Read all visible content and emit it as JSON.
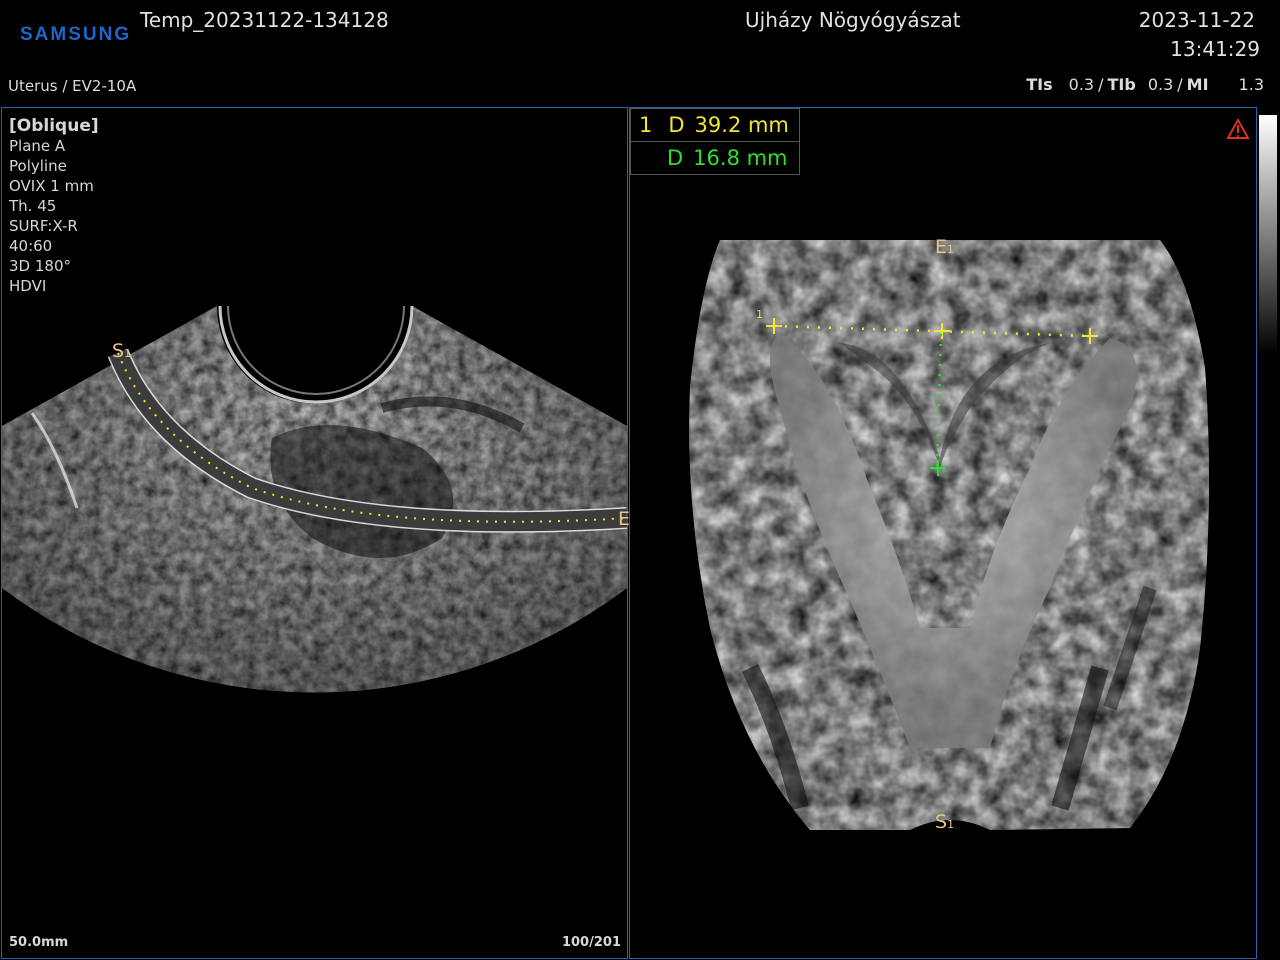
{
  "header": {
    "brand": "SAMSUNG",
    "file_name": "Temp_20231122-134128",
    "institution": "Ujházy Nögyógyászat",
    "date": "2023-11-22",
    "time": "13:41:29",
    "probe": "Uterus / EV2-10A",
    "tis_label": "TIs",
    "tis_value": "0.3",
    "tib_label": "TIb",
    "tib_value": "0.3",
    "mi_label": "MI",
    "mi_value": "1.3"
  },
  "left_panel": {
    "info": [
      "[Oblique]",
      "Plane A",
      "Polyline",
      "OVIX 1 mm",
      "Th. 45",
      "SURF:X-R",
      "40:60",
      "3D 180°",
      "HDVI"
    ],
    "start_marker": "S",
    "start_sub": "1",
    "end_marker": "E",
    "depth": "50.0mm",
    "frame": "100/201"
  },
  "right_panel": {
    "measurements": [
      {
        "index": "1",
        "label": "D",
        "value": "39.2 mm",
        "color": "#f2e536"
      },
      {
        "index": "",
        "label": "D",
        "value": "16.8 mm",
        "color": "#2ee02e"
      }
    ],
    "top_marker": "E",
    "top_sub": "1",
    "bottom_marker": "S",
    "bottom_sub": "1",
    "caliper_index": "1"
  },
  "colors": {
    "panel_border": "#2f5fa8",
    "yellow": "#f2e536",
    "green": "#2ee02e",
    "marker_orange": "#e8c48a",
    "warning_red": "#e0302a"
  }
}
